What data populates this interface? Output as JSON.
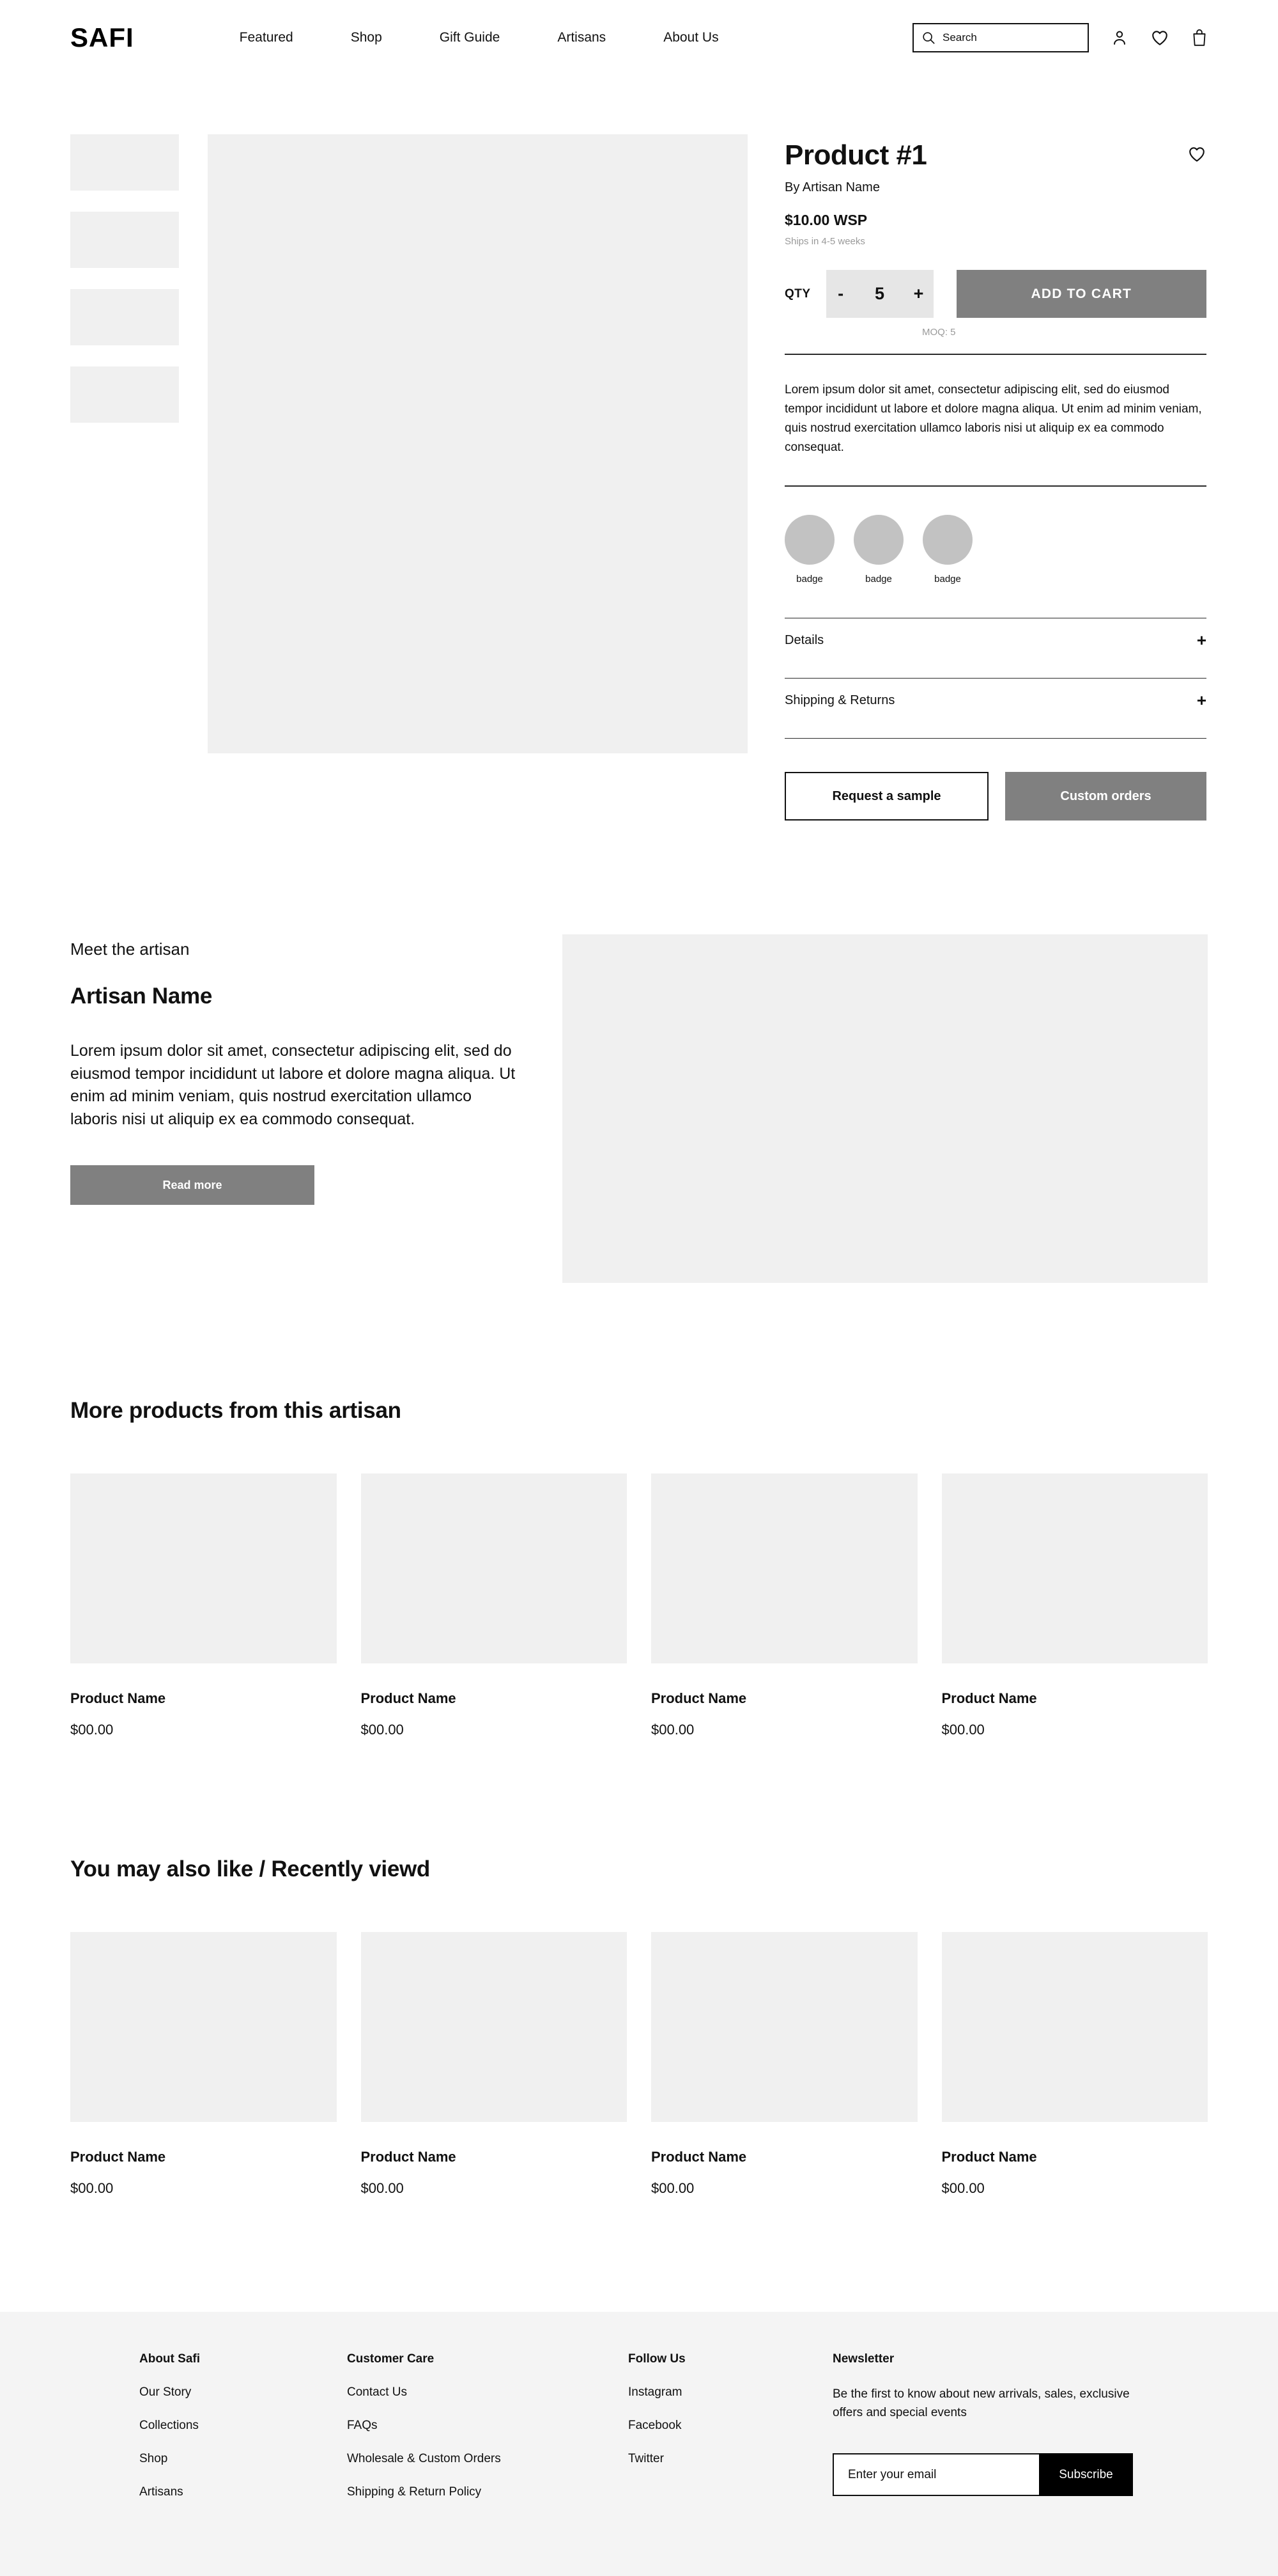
{
  "header": {
    "logo": "SAFI",
    "nav": [
      {
        "label": "Featured"
      },
      {
        "label": "Shop"
      },
      {
        "label": "Gift Guide"
      },
      {
        "label": "Artisans"
      },
      {
        "label": "About Us"
      }
    ],
    "search": {
      "placeholder": "Search",
      "value": "Search",
      "icon": "search-icon"
    },
    "icons": [
      {
        "name": "account-icon"
      },
      {
        "name": "wishlist-heart-icon"
      },
      {
        "name": "shopping-bag-icon"
      }
    ]
  },
  "gallery": {
    "thumbnails": [
      "thumbnail-1",
      "thumbnail-2",
      "thumbnail-3",
      "thumbnail-4"
    ],
    "main_image": "product-main-image"
  },
  "product": {
    "title": "Product #1",
    "by_artisan": "By Artisan Name",
    "price": "$10.00 WSP",
    "ships": "Ships in 4-5 weeks",
    "qty_label": "QTY",
    "decrement": "-",
    "increment": "+",
    "qty_value": "5",
    "add_to_cart": "ADD TO CART",
    "moq": "MOQ: 5",
    "description": "Lorem ipsum dolor sit amet, consectetur adipiscing elit, sed do eiusmod tempor incididunt ut labore et dolore magna aliqua. Ut enim ad minim veniam, quis nostrud exercitation ullamco laboris nisi ut aliquip ex ea commodo consequat.",
    "badges": [
      {
        "label": "badge"
      },
      {
        "label": "badge"
      },
      {
        "label": "badge"
      }
    ],
    "accordions": [
      {
        "label": "Details",
        "toggle": "+"
      },
      {
        "label": "Shipping & Returns",
        "toggle": "+"
      }
    ],
    "request_sample": "Request a sample",
    "custom_orders": "Custom orders",
    "wishlist_icon": "heart-outline-icon"
  },
  "artisan": {
    "eyebrow": "Meet the artisan",
    "name": "Artisan Name",
    "bio": "Lorem ipsum dolor sit amet, consectetur adipiscing elit, sed do eiusmod tempor incididunt ut labore et dolore magna aliqua. Ut enim ad minim veniam, quis nostrud exercitation ullamco laboris nisi ut aliquip ex ea commodo consequat.",
    "read_more": "Read more",
    "image": "artisan-image"
  },
  "more_products": {
    "heading": "More products from this artisan",
    "items": [
      {
        "name": "Product Name",
        "price": "$00.00"
      },
      {
        "name": "Product Name",
        "price": "$00.00"
      },
      {
        "name": "Product Name",
        "price": "$00.00"
      },
      {
        "name": "Product Name",
        "price": "$00.00"
      }
    ]
  },
  "recommendations": {
    "heading": "You may also like / Recently viewd",
    "items": [
      {
        "name": "Product Name",
        "price": "$00.00"
      },
      {
        "name": "Product Name",
        "price": "$00.00"
      },
      {
        "name": "Product Name",
        "price": "$00.00"
      },
      {
        "name": "Product Name",
        "price": "$00.00"
      }
    ]
  },
  "footer": {
    "about": {
      "title": "About Safi",
      "links": [
        {
          "label": "Our Story"
        },
        {
          "label": "Collections"
        },
        {
          "label": "Shop"
        },
        {
          "label": "Artisans"
        }
      ]
    },
    "care": {
      "title": "Customer Care",
      "links": [
        {
          "label": "Contact Us"
        },
        {
          "label": "FAQs"
        },
        {
          "label": "Wholesale & Custom Orders"
        },
        {
          "label": "Shipping & Return Policy"
        }
      ]
    },
    "follow": {
      "title": "Follow Us",
      "links": [
        {
          "label": "Instagram"
        },
        {
          "label": "Facebook"
        },
        {
          "label": "Twitter"
        }
      ]
    },
    "newsletter": {
      "title": "Newsletter",
      "text": "Be the first to know about new arrivals, sales, exclusive offers and special events",
      "placeholder": "Enter your email",
      "subscribe": "Subscribe"
    }
  },
  "colors": {
    "page_bg": "#ffffff",
    "placeholder_gray": "#f0f0f0",
    "badge_gray": "#c2c2c2",
    "button_gray": "#808080",
    "stepper_gray": "#e6e6e6",
    "footer_bg": "#f4f4f4",
    "muted_text": "#9a9a9a",
    "text": "#111111"
  }
}
